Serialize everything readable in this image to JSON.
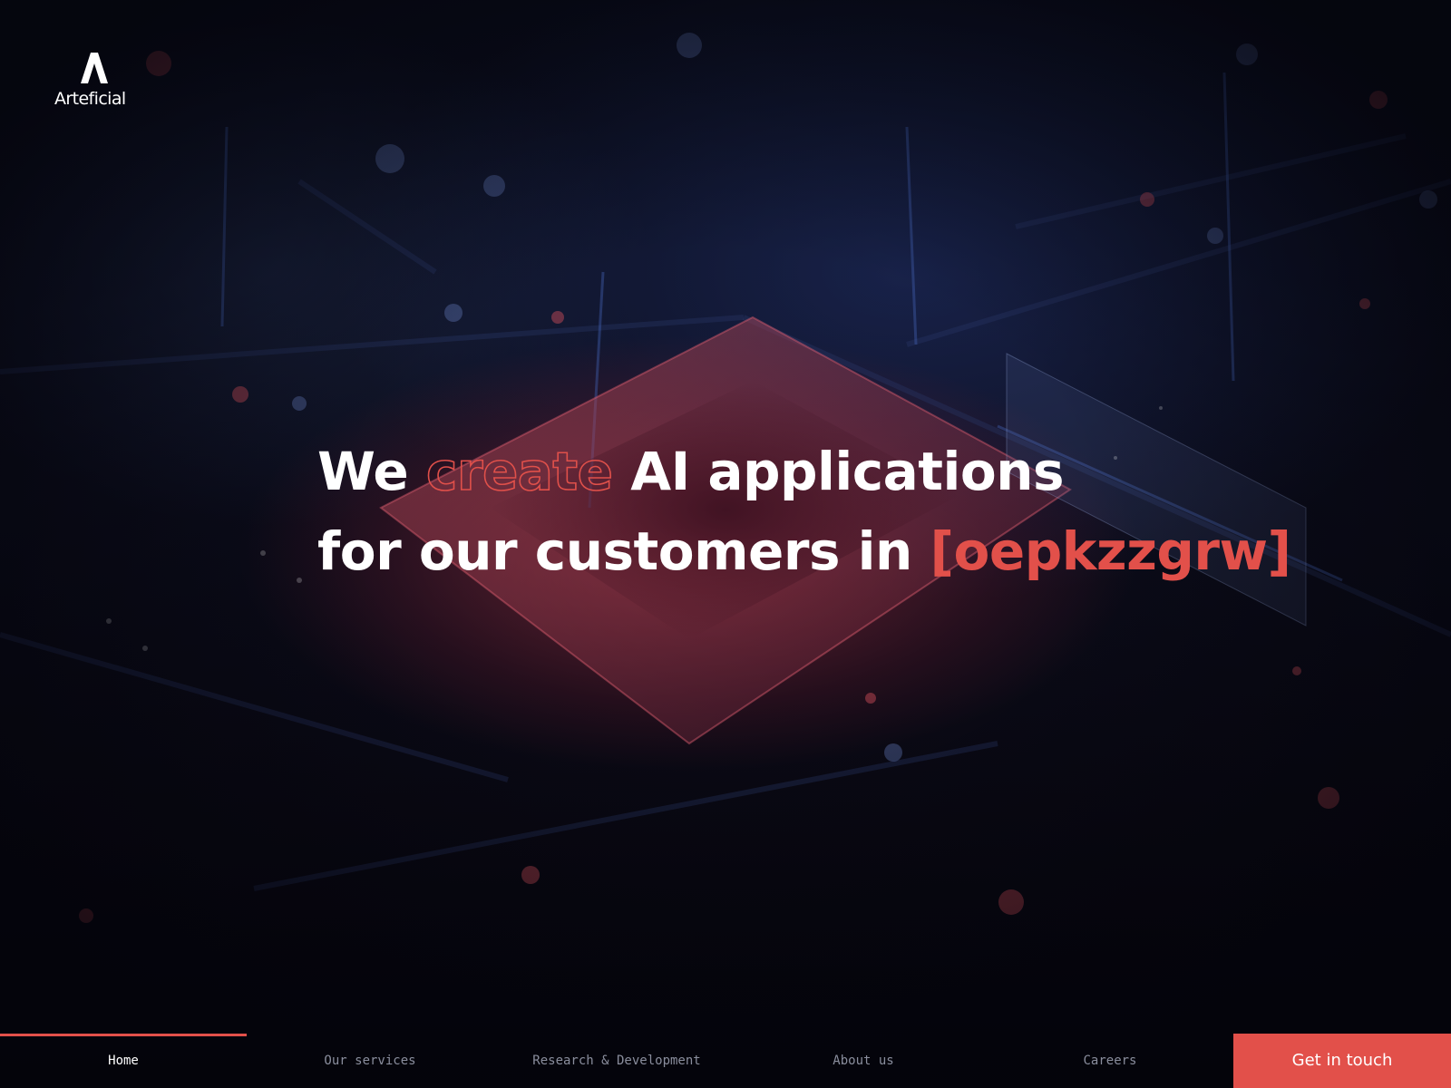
{
  "brand": {
    "name": "Arteficial",
    "logo_icon": "arteficial-a-logo-icon"
  },
  "hero": {
    "line1": {
      "word1": "We",
      "word2": "create",
      "word3": "AI applications"
    },
    "line2": {
      "prefix": "for our customers in",
      "highlight": "[oepkzzgrw]"
    }
  },
  "nav": {
    "items": [
      {
        "label": "Home",
        "active": true
      },
      {
        "label": "Our services",
        "active": false
      },
      {
        "label": "Research & Development",
        "active": false
      },
      {
        "label": "About us",
        "active": false
      },
      {
        "label": "Careers",
        "active": false
      }
    ],
    "cta_label": "Get in touch"
  },
  "colors": {
    "accent": "#e2504a",
    "background": "#05060f",
    "text": "#ffffff",
    "nav_text": "#8a8e9d"
  }
}
